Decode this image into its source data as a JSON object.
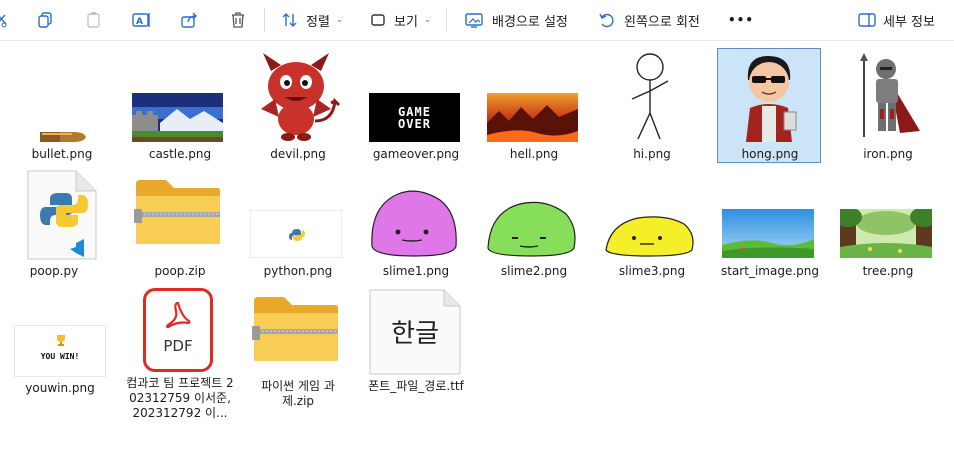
{
  "toolbar": {
    "sort_label": "정렬",
    "view_label": "보기",
    "set_background_label": "배경으로 설정",
    "rotate_left_label": "왼쪽으로 회전",
    "more_label": "•••",
    "details_label": "세부 정보"
  },
  "files": [
    {
      "name": "bullet.png"
    },
    {
      "name": "castle.png"
    },
    {
      "name": "devil.png"
    },
    {
      "name": "gameover.png"
    },
    {
      "name": "hell.png"
    },
    {
      "name": "hi.png"
    },
    {
      "name": "hong.png",
      "selected": true
    },
    {
      "name": "iron.png"
    },
    {
      "name": "poop.py"
    },
    {
      "name": "poop.zip"
    },
    {
      "name": "python.png"
    },
    {
      "name": "slime1.png"
    },
    {
      "name": "slime2.png"
    },
    {
      "name": "slime3.png"
    },
    {
      "name": "start_image.png"
    },
    {
      "name": "tree.png"
    },
    {
      "name": "youwin.png"
    },
    {
      "name": "컴과코 팀 프로젝트 202312759 이서준, 202312792 이..."
    },
    {
      "name": "파이썬 게임 과제.zip"
    },
    {
      "name": "폰트_파일_경로.ttf"
    }
  ],
  "thumbnails": {
    "gameover_text": [
      "GAME",
      "OVER"
    ],
    "youwin_text": "YOU WIN!",
    "pdf_text": "PDF",
    "font_preview_text": "한글"
  },
  "colors": {
    "selection_fill": "#cce4f7",
    "selection_border": "#5c8fc4",
    "folder_yellow": "#f5c84c",
    "pdf_red": "#e02b20"
  }
}
